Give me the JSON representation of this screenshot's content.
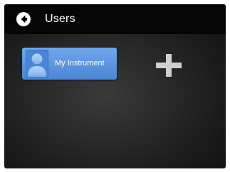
{
  "header": {
    "title": "Users",
    "back_icon": "arrow-left-circle-icon"
  },
  "users": [
    {
      "label": "My Instrument",
      "icon": "user-avatar-icon"
    }
  ],
  "add_icon": "plus-icon",
  "colors": {
    "tile_blue": "#5b95e0",
    "header_bg": "#050505",
    "plus_gray": "#cfcfcf"
  }
}
